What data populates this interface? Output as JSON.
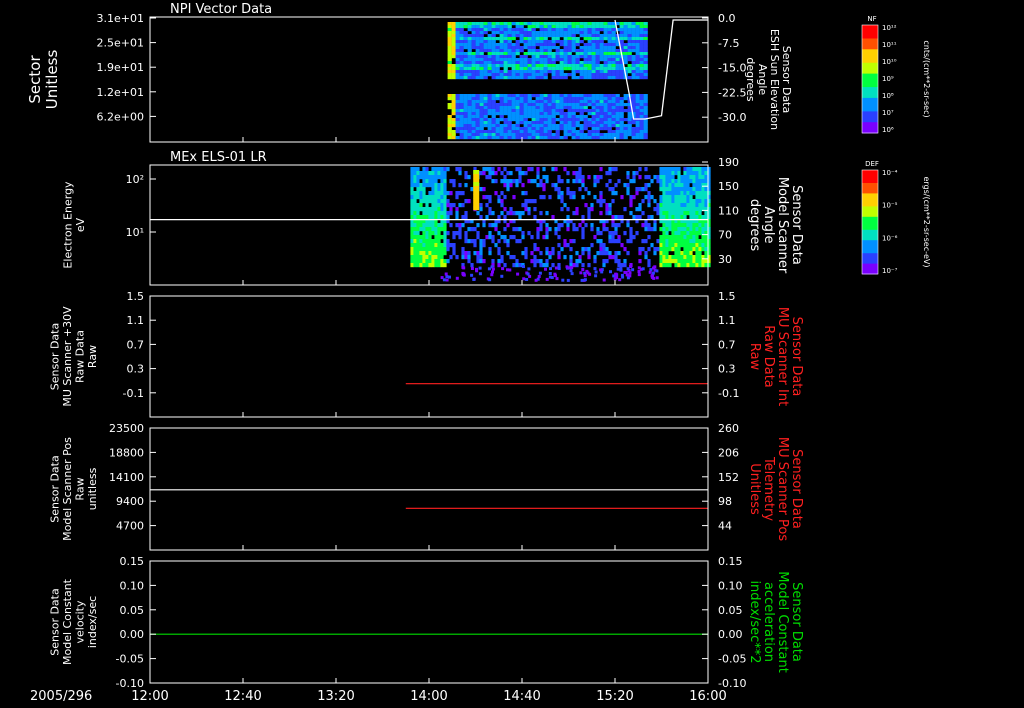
{
  "date": "2005/296",
  "time_ticks": [
    "12:00",
    "12:40",
    "13:20",
    "14:00",
    "14:40",
    "15:20",
    "16:00"
  ],
  "colorbars": [
    {
      "id": "nf",
      "label": "NF",
      "unit": "cnts/(cm**2-sr-sec)",
      "ticks": [
        "10¹²",
        "10¹¹",
        "10¹⁰",
        "10⁹",
        "10⁸",
        "10⁷",
        "10⁶"
      ]
    },
    {
      "id": "def",
      "label": "DEF",
      "unit": "ergs/(cm**2-sr-sec-eV)",
      "ticks": [
        "10⁻⁴",
        "10⁻⁵",
        "10⁻⁶",
        "10⁻⁷"
      ]
    }
  ],
  "colors": {
    "white": "#ffffff",
    "red": "#ff2020",
    "green": "#00dd00",
    "spectrum": [
      "#7a00ff",
      "#2a40ff",
      "#0090ff",
      "#00e0c0",
      "#00ff40",
      "#c0ff00",
      "#ffd000",
      "#ff5000",
      "#ff0000"
    ]
  },
  "chart_data": [
    {
      "type": "heatmap",
      "title": "NPI Vector Data",
      "ylabel": [
        "Sector",
        "Unitless"
      ],
      "y_ticks": [
        "3.1e+01",
        "2.5e+01",
        "1.9e+01",
        "1.2e+01",
        "6.2e+00"
      ],
      "y_right_ticks": [
        "0.0",
        "-7.5",
        "-15.0",
        "-22.5",
        "-30.0"
      ],
      "y_right_label": [
        "Sensor Data",
        "ESH Sun Elevation",
        "Angle",
        "degrees"
      ],
      "data_span": [
        "14:08",
        "15:33"
      ],
      "overlay_line": {
        "name": "Sensor Data ESH Sun Elevation Angle",
        "times": [
          "15:20",
          "15:26",
          "15:28",
          "15:33",
          "15:40",
          "15:45",
          "16:00"
        ],
        "values": [
          0,
          -22,
          -30,
          -30,
          -29,
          0,
          0
        ]
      }
    },
    {
      "type": "heatmap",
      "title": "MEx ELS-01 LR",
      "ylabel": [
        "Electron Energy",
        "eV"
      ],
      "y_ticks": [
        "10²",
        "10¹"
      ],
      "y_right_ticks": [
        "190",
        "150",
        "110",
        "70",
        "30"
      ],
      "y_right_label": [
        "Sensor Data",
        "Model Scanner",
        "Angle",
        "degrees"
      ],
      "data_span": [
        "13:52",
        "16:00"
      ],
      "overlay_line": {
        "name": "Sensor Data Model Scanner Angle",
        "value": 100
      }
    },
    {
      "type": "line",
      "ylabel": [
        "Sensor Data",
        "MU Scanner +30V",
        "Raw Data",
        "Raw"
      ],
      "y_ticks": [
        "1.5",
        "1.1",
        "0.7",
        "0.3",
        "-0.1"
      ],
      "ylim": [
        -0.5,
        1.5
      ],
      "y_right_ticks": [
        "1.5",
        "1.1",
        "0.7",
        "0.3",
        "-0.1"
      ],
      "y_right_label": [
        "Sensor Data",
        "MU Scanner Int",
        "Raw Data",
        "Raw"
      ],
      "series": [
        {
          "name": "Sensor Data MU Scanner Int Raw Data",
          "color": "red",
          "x": [
            "13:50",
            "16:00"
          ],
          "values": [
            0.05,
            0.05
          ]
        }
      ]
    },
    {
      "type": "line",
      "ylabel": [
        "Sensor Data",
        "Model Scanner Pos",
        "Raw",
        "unitless"
      ],
      "y_ticks": [
        "23500",
        "18800",
        "14100",
        "9400",
        "4700"
      ],
      "ylim": [
        0,
        23500
      ],
      "y_right_ticks": [
        "260",
        "206",
        "152",
        "98",
        "44"
      ],
      "y_right_label": [
        "Sensor Data",
        "MU Scanner Pos",
        "Telemetry",
        "Unitless"
      ],
      "series": [
        {
          "name": "Sensor Data Model Scanner Pos Raw",
          "color": "white",
          "x": [
            "12:00",
            "16:00"
          ],
          "values": [
            11600,
            11600
          ]
        },
        {
          "name": "Sensor Data MU Scanner Pos Telemetry",
          "color": "red",
          "x": [
            "13:50",
            "16:00"
          ],
          "values": [
            90,
            90
          ],
          "axis": "right"
        }
      ]
    },
    {
      "type": "line",
      "ylabel": [
        "Sensor Data",
        "Model Constant",
        "velocity",
        "index/sec"
      ],
      "y_ticks": [
        "0.15",
        "0.10",
        "0.05",
        "0.00",
        "-0.05",
        "-0.10"
      ],
      "ylim": [
        -0.1,
        0.15
      ],
      "y_right_ticks": [
        "0.15",
        "0.10",
        "0.05",
        "0.00",
        "-0.05",
        "-0.10"
      ],
      "y_right_label": [
        "Sensor Data",
        "Model Constant",
        "acceleration",
        "index/sec**2"
      ],
      "series": [
        {
          "name": "Sensor Data Model Constant acceleration",
          "color": "green",
          "x": [
            "12:00",
            "16:00"
          ],
          "values": [
            0.0,
            0.0
          ]
        }
      ]
    }
  ]
}
